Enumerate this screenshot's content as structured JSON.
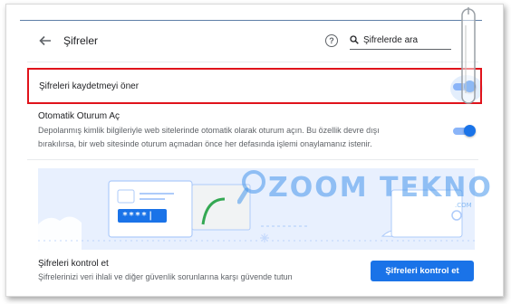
{
  "header": {
    "title": "Şifreler",
    "search_placeholder": "Şifrelerde ara"
  },
  "offer_to_save": {
    "label": "Şifreleri kaydetmeyi öner",
    "enabled": true
  },
  "auto_sign_in": {
    "title": "Otomatik Oturum Aç",
    "description": "Depolanmış kimlik bilgileriyle web sitelerinde otomatik olarak oturum açın. Bu özellik devre dışı bırakılırsa, bir web sitesinde oturum açmadan önce her defasında işlemi onaylamanız istenir.",
    "enabled": true
  },
  "password_check": {
    "illustration_password": "****|",
    "title": "Şifreleri kontrol et",
    "description": "Şifrelerinizi veri ihlali ve diğer güvenlik sorunlarına karşı güvende tutun",
    "button_label": "Şifreleri kontrol et"
  },
  "watermark": {
    "text": "ZOOM TEKNO",
    "sub": ".COM"
  },
  "colors": {
    "accent": "#1a73e8",
    "highlight_border": "#e0131b",
    "illustration_bg": "#e8f0fe"
  },
  "icons": {
    "back": "arrow-left-icon",
    "help": "help-circle-icon",
    "search": "search-icon"
  }
}
